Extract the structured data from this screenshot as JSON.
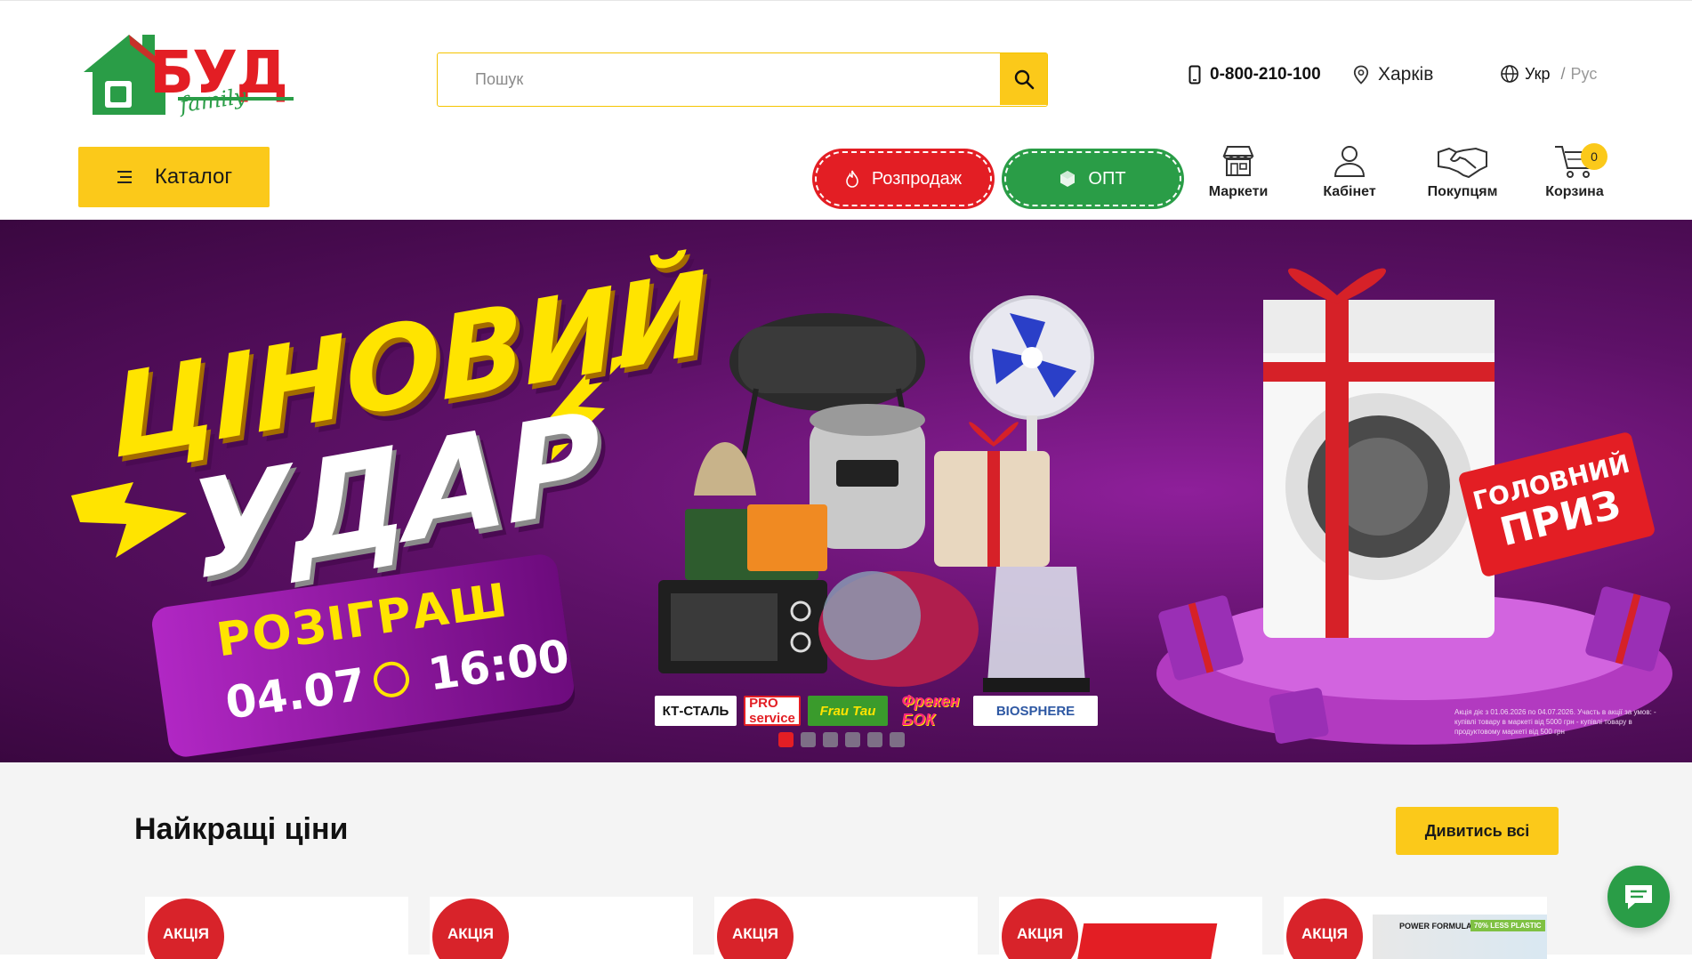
{
  "header": {
    "logo": {
      "word": "БУД",
      "sub": "family"
    },
    "search": {
      "placeholder": "Пошук",
      "value": ""
    },
    "phone": "0-800-210-100",
    "city": "Харків",
    "lang": {
      "active": "Укр",
      "separator": "/",
      "other": "Рус"
    },
    "catalog_label": "Каталог",
    "sale_label": "Розпродаж",
    "opt_label": "ОПТ",
    "nav": [
      {
        "label": "Маркети",
        "icon": "store-icon"
      },
      {
        "label": "Кабінет",
        "icon": "user-icon"
      },
      {
        "label": "Покупцям",
        "icon": "handshake-icon"
      },
      {
        "label": "Корзина",
        "icon": "cart-icon"
      }
    ],
    "cart_count": "0"
  },
  "banner": {
    "headline_1": "ЦІНОВИЙ",
    "headline_2": "УДАР",
    "draw_title": "РОЗІГРАШ",
    "draw_date": "04.07",
    "draw_time": "16:00",
    "prize_1": "ГОЛОВНИЙ",
    "prize_2": "ПРИЗ",
    "brands": [
      "КТ-СТАЛЬ",
      "PRO service",
      "Frau Tau",
      "Фрекен БОК",
      "BIOSPHERE"
    ],
    "terms": "Акція діє з 01.06.2026 по 04.07.2026. Участь в акції за умов: - купівлі товару в маркеті від 5000 грн - купівлі товару в продуктовому маркеті від 500 грн",
    "slide_count": 6,
    "active_slide": 1,
    "colors": {
      "background": "#5e1168",
      "headline": "#ffe400"
    }
  },
  "best_prices": {
    "title": "Найкращі ціни",
    "view_all": "Дивитись всі",
    "badge": "АКЦІЯ",
    "cards": 5,
    "pack_text": "POWER FORMULA",
    "pack_tag": "70% LESS PLASTIC"
  },
  "colors": {
    "accent": "#fbc91a",
    "brand_red": "#e31e24",
    "brand_green": "#2a9d47"
  }
}
